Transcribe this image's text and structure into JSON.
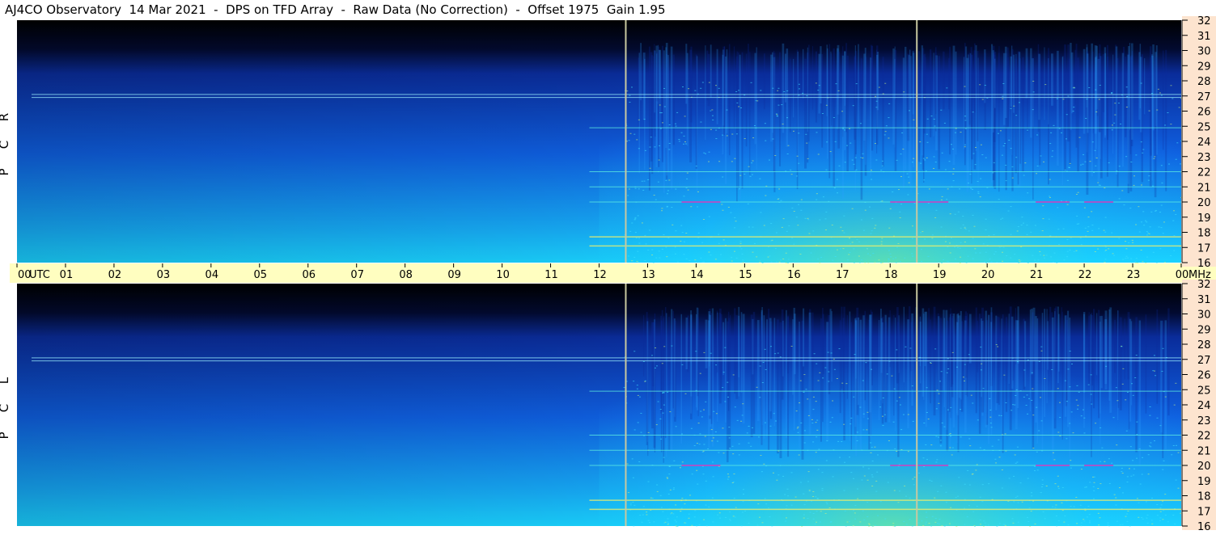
{
  "title": "AJ4CO Observatory  14 Mar 2021  -  DPS on TFD Array  -  Raw Data (No Correction)  -  Offset 1975  Gain 1.95",
  "chart_data": {
    "type": "heatmap",
    "x_axis": {
      "ticks": [
        "00",
        "01",
        "02",
        "03",
        "04",
        "05",
        "06",
        "07",
        "08",
        "09",
        "10",
        "11",
        "12",
        "13",
        "14",
        "15",
        "16",
        "17",
        "18",
        "19",
        "20",
        "21",
        "22",
        "23",
        "00"
      ],
      "unit_label_left": "UTC",
      "unit_label_right": "MHz",
      "range_hours": [
        0,
        24
      ]
    },
    "y_axis": {
      "ticks": [
        "16",
        "17",
        "18",
        "19",
        "20",
        "21",
        "22",
        "23",
        "24",
        "25",
        "26",
        "27",
        "28",
        "29",
        "30",
        "31",
        "32"
      ],
      "range_mhz": [
        16,
        32
      ]
    },
    "panels": [
      {
        "label_letters": [
          "R",
          "C",
          "P"
        ],
        "polarization": "RCP"
      },
      {
        "label_letters": [
          "L",
          "C",
          "P"
        ],
        "polarization": "LCP"
      }
    ],
    "time_markers_hours": [
      12.55,
      18.55
    ],
    "interference_lines_mhz": [
      17.1,
      17.7,
      20.0,
      21.0,
      22.0,
      24.9,
      26.9,
      27.1
    ],
    "colors": {
      "low": "#000000",
      "mid_low": "#0a2c9a",
      "mid": "#0f6fe8",
      "high": "#1ad2ff",
      "peak": "#f2f06a",
      "axis_band": "#fffec0",
      "right_axis_band": "#fde4cf",
      "marker_line": "#c8c8a0"
    }
  }
}
